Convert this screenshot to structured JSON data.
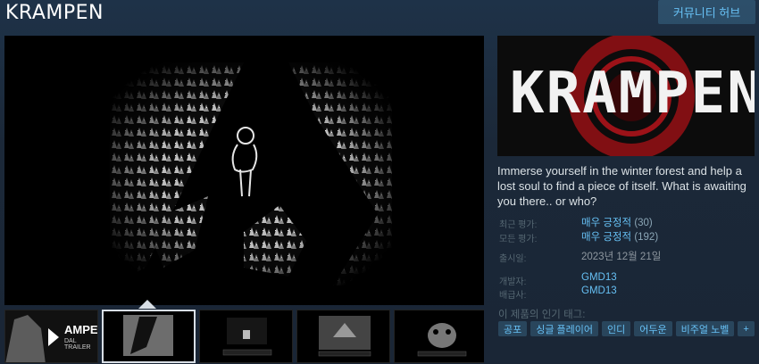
{
  "header": {
    "game_title": "KRAMPEN",
    "community_hub_label": "커뮤니티 허브"
  },
  "capsule": {
    "logo_text": "KRAMPEN"
  },
  "description": "Immerse yourself in the winter forest and help a lost soul to find a piece of itself. What is awaiting you there.. or who?",
  "reviews": {
    "recent_label": "최근 평가:",
    "recent_value": "매우 긍정적",
    "recent_count": "(30)",
    "all_label": "모든 평가:",
    "all_value": "매우 긍정적",
    "all_count": "(192)"
  },
  "release": {
    "label": "출시일:",
    "value": "2023년 12월 21일"
  },
  "developer": {
    "label": "개발자:",
    "value": "GMD13"
  },
  "publisher": {
    "label": "배급사:",
    "value": "GMD13"
  },
  "tags": {
    "label": "이 제품의 인기 태그:",
    "items": [
      "공포",
      "싱글 플레이어",
      "인디",
      "어두운",
      "비주얼 노벨",
      "+"
    ]
  },
  "thumbnails": {
    "trailer_text": "AMPEN",
    "trailer_subtext": "DAL TRAILER"
  },
  "colors": {
    "background": "#1b2838",
    "link": "#66c0f4",
    "accent_red": "#c0141b"
  }
}
